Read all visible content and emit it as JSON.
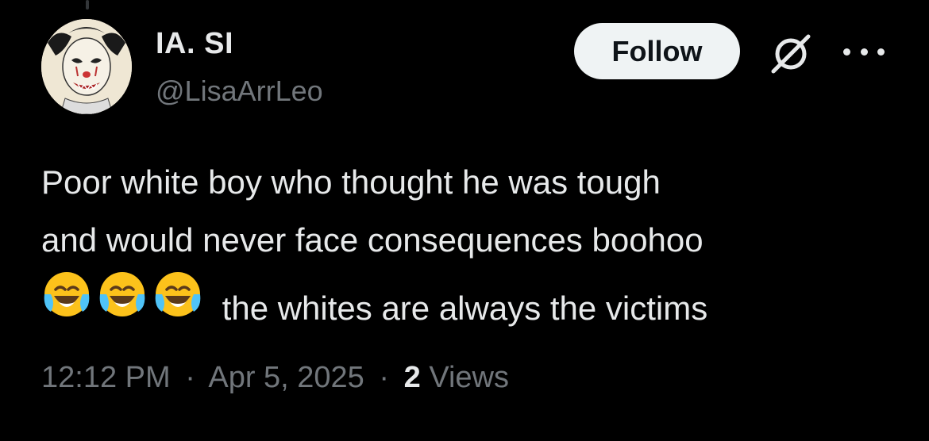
{
  "author": {
    "display_name": "IA. SI",
    "handle": "@LisaArrLeo",
    "avatar_icon": "clown-avatar"
  },
  "actions": {
    "follow_label": "Follow",
    "grok_icon": "grok-icon",
    "more_icon": "more-icon"
  },
  "tweet": {
    "line1": "Poor white boy who thought he was tough",
    "line2": "and would never face consequences boohoo",
    "emoji": "😂😂😂",
    "line3_text": "the whites are always the victims"
  },
  "meta": {
    "time": "12:12 PM",
    "separator1": "·",
    "date": "Apr 5, 2025",
    "separator2": "·",
    "views_count": "2",
    "views_label": "Views"
  },
  "colors": {
    "background": "#000000",
    "primary_text": "#e7e9ea",
    "secondary_text": "#71767b",
    "follow_bg": "#eff3f4"
  }
}
